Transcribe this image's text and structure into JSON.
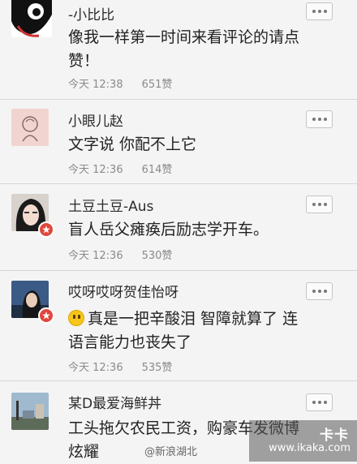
{
  "comments": [
    {
      "username": "-小比比",
      "content": "像我一样第一时间来看评论的请点赞！",
      "time": "今天 12:38",
      "likes": "651赞",
      "verified": false
    },
    {
      "username": "小眼儿赵",
      "content": "文字说 你配不上它",
      "time": "今天 12:36",
      "likes": "614赞",
      "verified": false
    },
    {
      "username": "土豆土豆-Aus",
      "content": "盲人岳父瘫痪后励志学开车。",
      "time": "今天 12:36",
      "likes": "530赞",
      "verified": true
    },
    {
      "username": "哎呀哎呀贺佳怡呀",
      "content": "真是一把辛酸泪 智障就算了 连语言能力也丧失了",
      "time": "今天 12:36",
      "likes": "535赞",
      "verified": true
    },
    {
      "username": "某D最爱海鲜丼",
      "content": "工头拖欠农民工资，购豪车发微博炫耀",
      "time": "",
      "likes": "",
      "verified": false
    }
  ],
  "watermark": {
    "brand": "卡卡",
    "url": "www.ikaka.com",
    "weibo": "@新浪湖北"
  },
  "colors": {
    "background": "#f4f4f4",
    "badge": "#e0463b",
    "meta_text": "#8a8a8a"
  }
}
